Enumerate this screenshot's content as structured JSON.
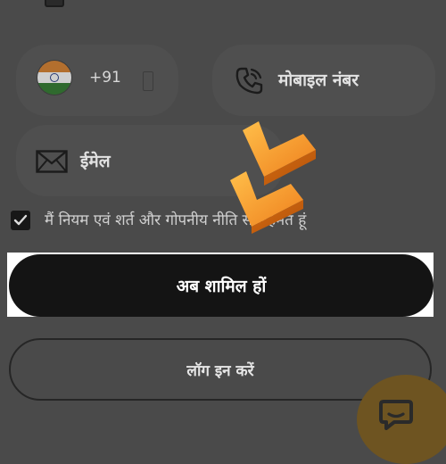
{
  "colors": {
    "overlay": "#4a4a4a",
    "primary_button": "#141414",
    "accent_orange": "#f29a2e",
    "chat_fab": "#6e5421"
  },
  "form": {
    "phone": {
      "country_flag_icon": "india-flag-icon",
      "country_code": "+91",
      "placeholder": "मोबाइल नंबर",
      "icon": "phone-icon"
    },
    "email": {
      "placeholder": "ईमेल",
      "icon": "mail-icon"
    },
    "terms": {
      "checked": true,
      "label": "मैं नियम एवं शर्त और गोपनीय नीति से सहमत हूं"
    }
  },
  "buttons": {
    "join_label": "अब शामिल हों",
    "login_label": "लॉग इन करें"
  },
  "overlay_logo": "orange-double-check-logo",
  "chat": {
    "icon": "chat-bubble-icon"
  }
}
